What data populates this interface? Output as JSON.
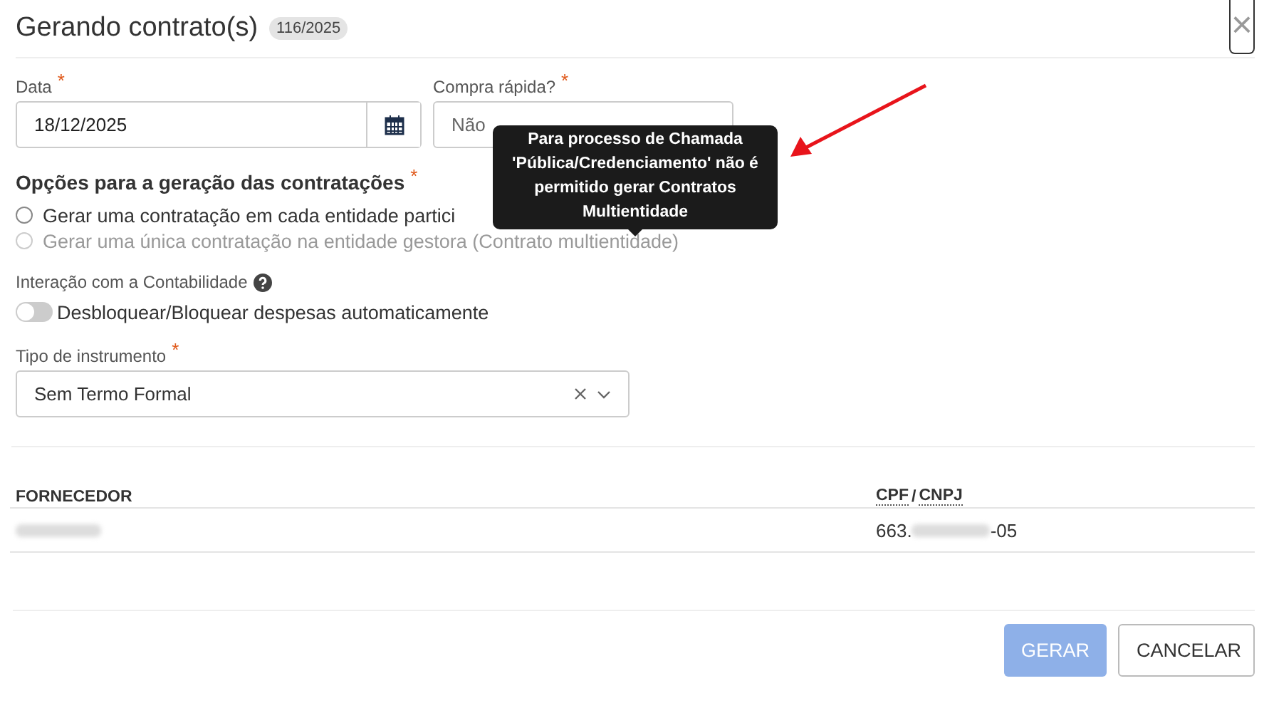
{
  "dialog": {
    "title": "Gerando contrato(s)",
    "badge": "116/2025",
    "close": "×"
  },
  "date_field": {
    "label": "Data",
    "required_mark": "*",
    "value": "18/12/2025"
  },
  "quick_purchase": {
    "label": "Compra rápida?",
    "required_mark": "*",
    "value": "Não"
  },
  "tooltip": {
    "text": "Para processo de Chamada 'Pública/Credenciamento' não é permitido gerar Contratos Multientidade"
  },
  "options": {
    "title": "Opções para a geração das contratações",
    "required_mark": "*",
    "items": [
      {
        "label": "Gerar uma contratação em cada entidade partici",
        "selected": false,
        "disabled": false
      },
      {
        "label": "Gerar uma única contratação na entidade gestora (Contrato multientidade)",
        "selected": false,
        "disabled": true
      }
    ]
  },
  "accounting": {
    "label": "Interação com a Contabilidade",
    "toggle_label": "Desbloquear/Bloquear despesas automaticamente",
    "on": false
  },
  "instrument": {
    "label": "Tipo de instrumento",
    "required_mark": "*",
    "value": "Sem Termo Formal"
  },
  "table": {
    "columns": [
      {
        "label": "FORNECEDOR"
      },
      {
        "parts": [
          "CPF",
          "/",
          "CNPJ"
        ]
      }
    ],
    "rows": [
      {
        "supplier_redacted": true,
        "doc_start": "663.",
        "doc_end": "-05"
      }
    ]
  },
  "buttons": [
    {
      "label": "GERAR",
      "kind": "primary",
      "disabled": true
    },
    {
      "label": "CANCELAR",
      "kind": "secondary",
      "disabled": false
    }
  ]
}
